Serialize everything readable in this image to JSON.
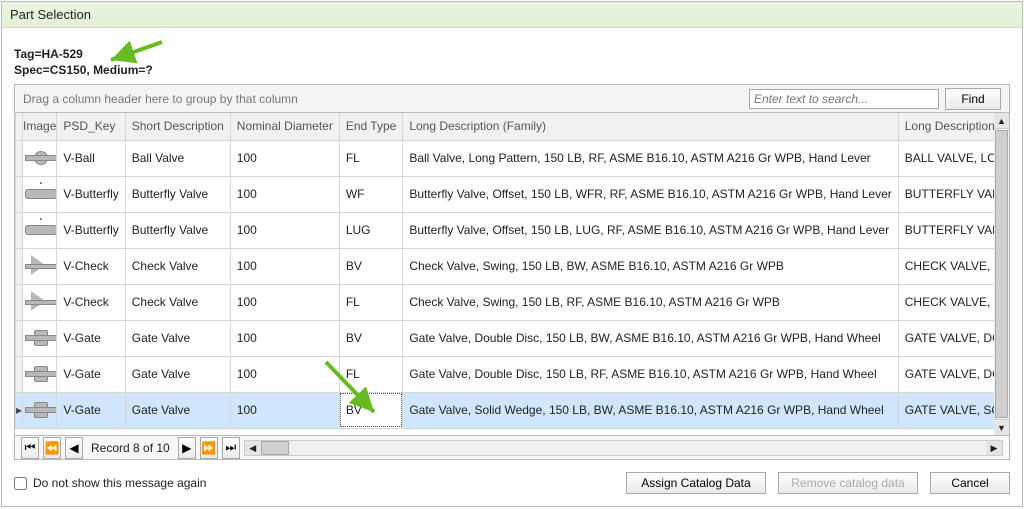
{
  "title": "Part Selection",
  "tag_line": "Tag=HA-529",
  "spec_prefix": "Spec=CS150, ",
  "spec_medium": "Medium=?",
  "group_hint": "Drag a column header here to group by that column",
  "search_placeholder": "Enter text to search...",
  "find_label": "Find",
  "columns": {
    "image": "Image",
    "psd_key": "PSD_Key",
    "short_desc": "Short Description",
    "nom_dia": "Nominal Diameter",
    "end_type": "End Type",
    "long_family": "Long Description (Family)",
    "long_size": "Long Description (Size)"
  },
  "rows": [
    {
      "icon": "vi-ball",
      "psd": "V-Ball",
      "short": "Ball Valve",
      "nd": "100",
      "et": "FL",
      "lf": "Ball Valve, Long Pattern, 150 LB, RF, ASME B16.10, ASTM A216 Gr WPB, Hand Lever",
      "ls": "BALL VALVE, LONG PAT"
    },
    {
      "icon": "vi-butterfly",
      "psd": "V-Butterfly",
      "short": "Butterfly Valve",
      "nd": "100",
      "et": "WF",
      "lf": "Butterfly Valve, Offset, 150 LB, WFR, RF, ASME B16.10, ASTM A216 Gr WPB, Hand Lever",
      "ls": "BUTTERFLY VALVE, OFF"
    },
    {
      "icon": "vi-butterfly",
      "psd": "V-Butterfly",
      "short": "Butterfly Valve",
      "nd": "100",
      "et": "LUG",
      "lf": "Butterfly Valve, Offset, 150 LB, LUG, RF, ASME B16.10, ASTM A216 Gr WPB, Hand Lever",
      "ls": "BUTTERFLY VALVE, OFF"
    },
    {
      "icon": "vi-check",
      "psd": "V-Check",
      "short": "Check Valve",
      "nd": "100",
      "et": "BV",
      "lf": "Check Valve, Swing, 150 LB, BW, ASME B16.10, ASTM A216 Gr WPB",
      "ls": "CHECK VALVE, SWING,"
    },
    {
      "icon": "vi-check",
      "psd": "V-Check",
      "short": "Check Valve",
      "nd": "100",
      "et": "FL",
      "lf": "Check Valve, Swing, 150 LB, RF, ASME B16.10, ASTM A216 Gr WPB",
      "ls": "CHECK VALVE, SWING,"
    },
    {
      "icon": "vi-gate",
      "psd": "V-Gate",
      "short": "Gate Valve",
      "nd": "100",
      "et": "BV",
      "lf": "Gate Valve, Double Disc, 150 LB, BW, ASME B16.10, ASTM A216 Gr WPB, Hand Wheel",
      "ls": "GATE VALVE, DOUBLE D"
    },
    {
      "icon": "vi-gate",
      "psd": "V-Gate",
      "short": "Gate Valve",
      "nd": "100",
      "et": "FL",
      "lf": "Gate Valve, Double Disc, 150 LB, RF, ASME B16.10, ASTM A216 Gr WPB, Hand Wheel",
      "ls": "GATE VALVE, DOUBLE D"
    },
    {
      "icon": "vi-gate",
      "psd": "V-Gate",
      "short": "Gate Valve",
      "nd": "100",
      "et": "BV",
      "lf": "Gate Valve, Solid Wedge, 150 LB, BW, ASME B16.10, ASTM A216 Gr WPB, Hand Wheel",
      "ls": "GATE VALVE, SOLID WE",
      "selected": true
    }
  ],
  "selected_index": 7,
  "record_label": "Record 8 of 10",
  "nav": {
    "first": "⏮",
    "prev": "◀",
    "prevpage": "⏪",
    "nextpage": "⏩",
    "next": "▶",
    "last": "⏭"
  },
  "checkbox_label": "Do not show this message again",
  "buttons": {
    "assign": "Assign Catalog Data",
    "remove": "Remove catalog data",
    "cancel": "Cancel"
  }
}
